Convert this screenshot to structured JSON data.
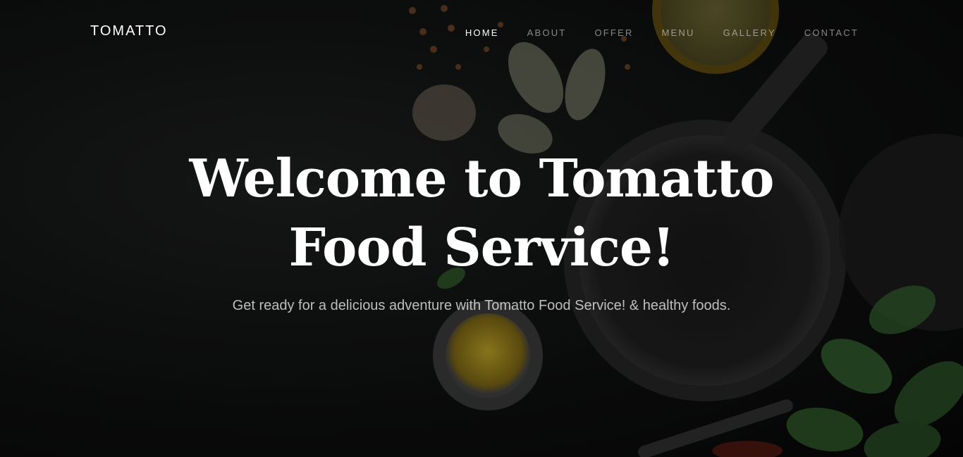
{
  "brand": {
    "name": "TOMATTO"
  },
  "nav": {
    "items": [
      {
        "label": "HOME",
        "active": true
      },
      {
        "label": "ABOUT",
        "active": false
      },
      {
        "label": "OFFER",
        "active": false
      },
      {
        "label": "MENU",
        "active": false
      },
      {
        "label": "GALLERY",
        "active": false
      },
      {
        "label": "CONTACT",
        "active": false
      }
    ]
  },
  "hero": {
    "title": "Welcome to Tomatto Food Service!",
    "subtitle": "Get ready for a delicious adventure with Tomatto Food Service! & healthy foods."
  },
  "colors": {
    "background": "#0a0a0a",
    "text": "#ffffff",
    "nav_inactive": "#8a8a8a",
    "oil": "#b59a24",
    "bowl_rim": "#c9a227",
    "basil": "#2f5a2a"
  }
}
